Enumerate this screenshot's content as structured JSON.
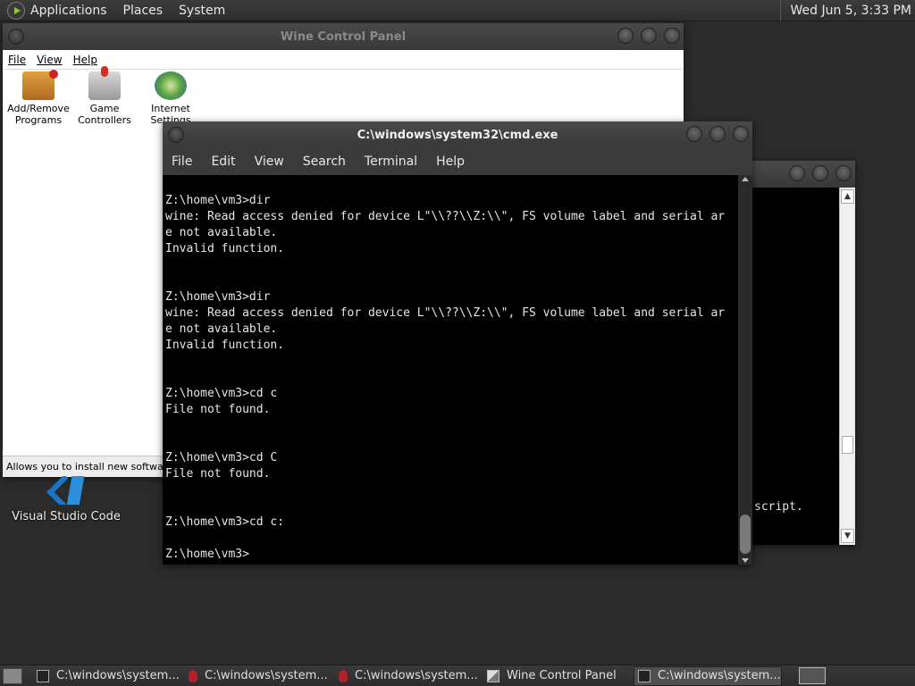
{
  "top_panel": {
    "menus": [
      "Applications",
      "Places",
      "System"
    ],
    "clock": "Wed Jun  5,  3:33 PM"
  },
  "control_panel": {
    "title": "Wine Control Panel",
    "menu": [
      "File",
      "View",
      "Help"
    ],
    "applets": [
      {
        "line1": "Add/Remove",
        "line2": "Programs",
        "icon": "add-remove-programs-icon"
      },
      {
        "line1": "Game",
        "line2": "Controllers",
        "icon": "game-controllers-icon"
      },
      {
        "line1": "Internet",
        "line2": "Settings",
        "icon": "internet-settings-icon"
      }
    ],
    "status": "Allows you to install new software, c"
  },
  "desktop": {
    "icons": [
      {
        "label": "Visual Studio Code",
        "icon": "vscode-icon"
      }
    ]
  },
  "background_window": {
    "visible_text": "script."
  },
  "cmd_window": {
    "title": "C:\\windows\\system32\\cmd.exe",
    "menu": [
      "File",
      "Edit",
      "View",
      "Search",
      "Terminal",
      "Help"
    ],
    "output_lines": [
      "Z:\\home\\vm3>dir",
      "wine: Read access denied for device L\"\\\\??\\\\Z:\\\\\", FS volume label and serial ar",
      "e not available.",
      "Invalid function.",
      "",
      "",
      "Z:\\home\\vm3>dir",
      "wine: Read access denied for device L\"\\\\??\\\\Z:\\\\\", FS volume label and serial ar",
      "e not available.",
      "Invalid function.",
      "",
      "",
      "Z:\\home\\vm3>cd c",
      "File not found.",
      "",
      "",
      "Z:\\home\\vm3>cd C",
      "File not found.",
      "",
      "",
      "Z:\\home\\vm3>cd c:",
      "",
      "Z:\\home\\vm3>"
    ]
  },
  "taskbar": {
    "tasks": [
      {
        "label": "C:\\windows\\system...",
        "icon": "cmd-icon",
        "active": false
      },
      {
        "label": "C:\\windows\\system...",
        "icon": "wine-icon",
        "active": false
      },
      {
        "label": "C:\\windows\\system...",
        "icon": "wine-icon",
        "active": false
      },
      {
        "label": "Wine Control Panel",
        "icon": "control-panel-icon",
        "active": false
      },
      {
        "label": "C:\\windows\\system...",
        "icon": "cmd-icon",
        "active": true
      }
    ]
  }
}
